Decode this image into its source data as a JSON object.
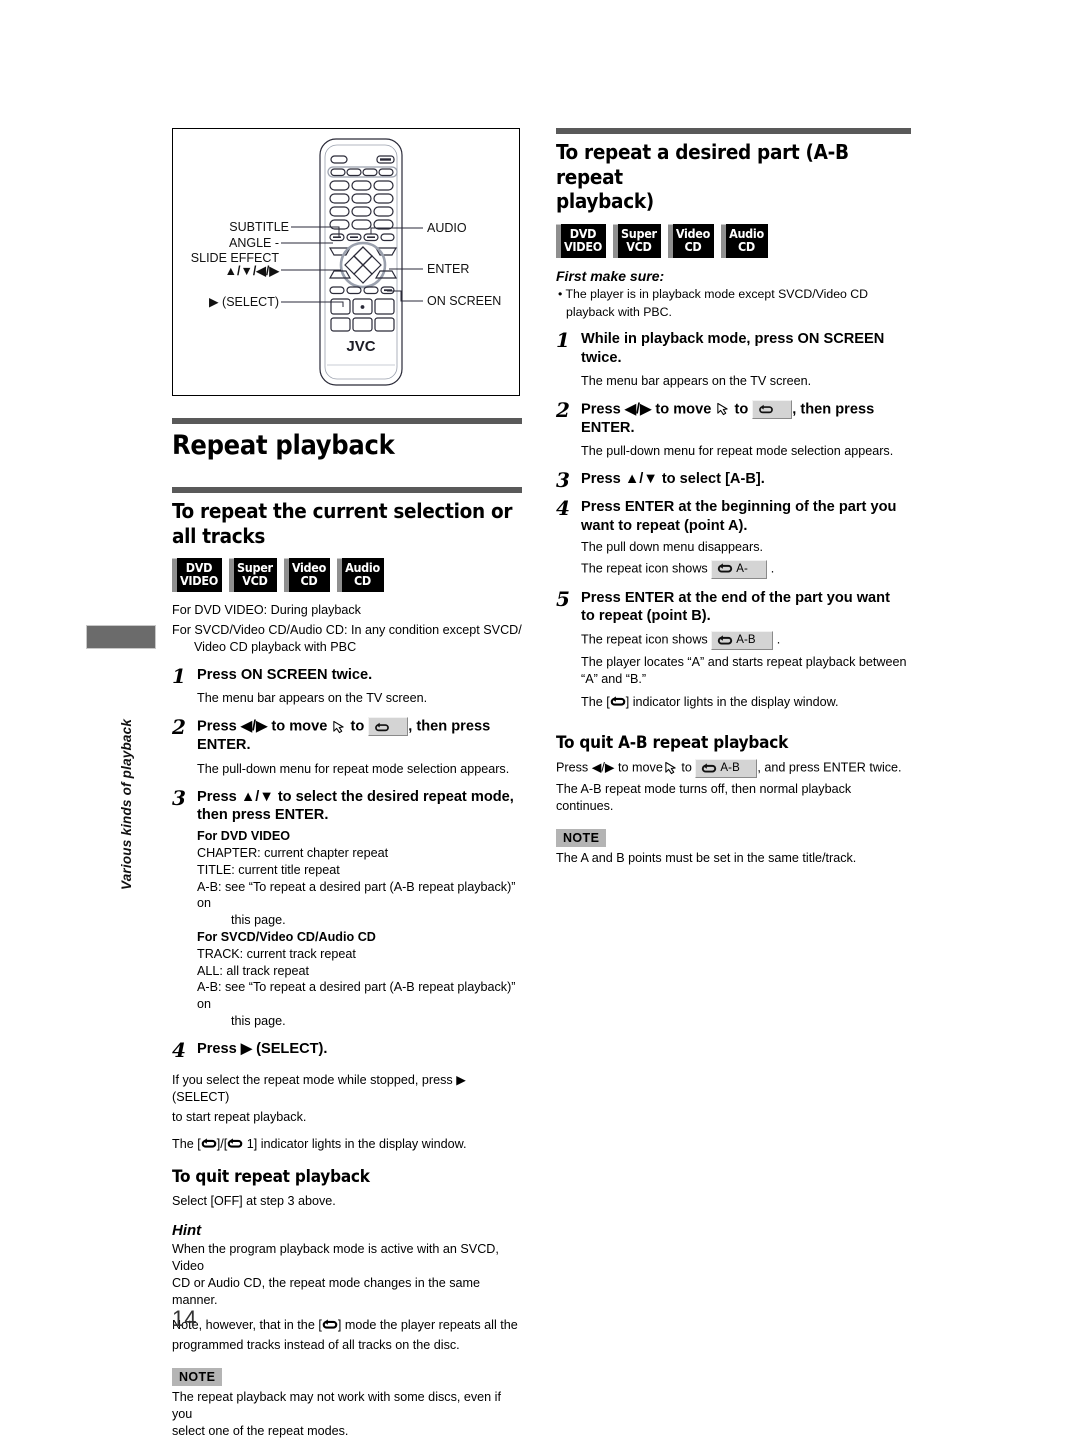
{
  "page": {
    "number": "14"
  },
  "side_tab": {
    "label": "Various kinds of playback"
  },
  "figure": {
    "name": "remote-control-diagram",
    "brand": "JVC",
    "labels": {
      "subtitle": "SUBTITLE",
      "angle": "ANGLE -",
      "slide_effect": "SLIDE EFFECT",
      "dpad": "▲/▼/◀/▶",
      "select": "▶ (SELECT)",
      "audio": "AUDIO",
      "enter": "ENTER",
      "on_screen": "ON SCREEN"
    }
  },
  "discs": [
    {
      "line1": "DVD",
      "line2": "VIDEO"
    },
    {
      "line1": "Super",
      "line2": "VCD"
    },
    {
      "line1": "Video",
      "line2": "CD"
    },
    {
      "line1": "Audio",
      "line2": "CD"
    }
  ],
  "left": {
    "section_title": "Repeat playback",
    "heading": "To repeat the current selection or all tracks",
    "conditions": [
      "For DVD VIDEO: During playback",
      "For SVCD/Video CD/Audio CD: In any condition except SVCD/",
      "Video CD playback with PBC"
    ],
    "steps": {
      "s1_num": "1",
      "s1_title": "Press ON SCREEN twice.",
      "s1_sub": "The menu bar appears on the TV screen.",
      "s2_num": "2",
      "s2_a": "Press ◀/▶ to move",
      "s2_b": "to",
      "s2_c": ", then press",
      "s2_d": "ENTER.",
      "s2_sub": "The pull-down menu for repeat mode selection appears.",
      "s3_num": "3",
      "s3_title_1": "Press ▲/▼ to select the desired repeat mode,",
      "s3_title_2": "then press ENTER.",
      "s3_dvd_label": "For DVD VIDEO",
      "s3_dvd_items": [
        "CHAPTER: current chapter repeat",
        "TITLE: current title repeat",
        "A-B: see “To repeat a desired part (A-B repeat playback)” on",
        "this page."
      ],
      "s3_cd_label": "For SVCD/Video CD/Audio CD",
      "s3_cd_items": [
        "TRACK: current track repeat",
        "ALL: all track repeat",
        "A-B: see “To repeat a desired part (A-B repeat playback)” on",
        "this page."
      ],
      "s4_num": "4",
      "s4_title": "Press ▶ (SELECT).",
      "s4_sub_1": "If you select the repeat mode while stopped, press ▶ (SELECT)",
      "s4_sub_2": "to start repeat playback.",
      "s4_indicator_pre": "The [",
      "s4_indicator_mid": "]/[",
      "s4_indicator_num": "1]",
      "s4_indicator_post": "indicator lights in the display window."
    },
    "quit_heading": "To quit repeat playback",
    "quit_text": "Select [OFF] at step 3 above.",
    "hint_title": "Hint",
    "hint_p1_1": "When the program playback mode is active with an SVCD, Video",
    "hint_p1_2": "CD or Audio CD, the repeat mode changes in the same manner.",
    "hint_p2_pre": "Note, however, that in the [",
    "hint_p2_post": "] mode the player repeats all the",
    "hint_p2_2": "programmed tracks instead of all tracks on the disc.",
    "note_badge": "NOTE",
    "note_1": "The repeat playback may not work with some discs, even if you",
    "note_2": "select one of the repeat modes."
  },
  "right": {
    "heading_1": "To repeat a desired part (A-B repeat",
    "heading_2": "playback)",
    "first_make_sure": "First make sure:",
    "first_make_bullet_1": "• The player is in playback mode except SVCD/Video CD",
    "first_make_bullet_2": "playback with PBC.",
    "steps": {
      "s1_num": "1",
      "s1_title_1": "While in playback mode, press ON SCREEN",
      "s1_title_2": "twice.",
      "s1_sub": "The menu bar appears on the TV screen.",
      "s2_num": "2",
      "s2_a": "Press ◀/▶ to move",
      "s2_b": "to",
      "s2_c": ", then press",
      "s2_d": "ENTER.",
      "s2_sub": "The pull-down menu for repeat mode selection appears.",
      "s3_num": "3",
      "s3_title": "Press ▲/▼ to select [A-B].",
      "s4_num": "4",
      "s4_title_1": "Press ENTER at the beginning of the part you",
      "s4_title_2": "want to repeat (point A).",
      "s4_sub_1": "The pull down menu disappears.",
      "s4_sub_2_pre": "The repeat icon shows",
      "s4_sub_2_key": "A-",
      "s4_sub_2_post": ".",
      "s5_num": "5",
      "s5_title_1": "Press ENTER at the end of the part you want",
      "s5_title_2": "to repeat (point B).",
      "s5_sub_1_pre": "The repeat icon shows",
      "s5_sub_1_key": "A-B",
      "s5_sub_1_post": ".",
      "s5_sub_2_1": "The player locates “A” and starts repeat playback between",
      "s5_sub_2_2": "“A” and “B.”",
      "s5_sub_3_pre": "The [",
      "s5_sub_3_post": "] indicator lights in the display window."
    },
    "quit_heading": "To quit A-B repeat playback",
    "quit_1_a": "Press ◀/▶ to move",
    "quit_1_b": "to",
    "quit_1_key": "A-B",
    "quit_1_c": ", and press ENTER twice.",
    "quit_2": "The A-B repeat mode turns off, then normal playback continues.",
    "note_badge": "NOTE",
    "note_1": "The A and B points must be set in the same title/track."
  }
}
